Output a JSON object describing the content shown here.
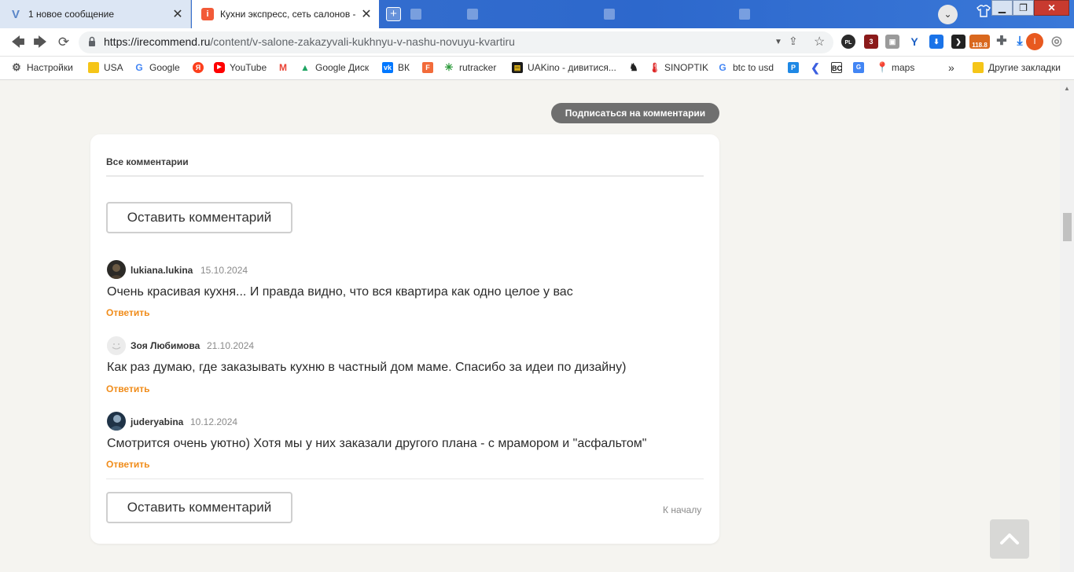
{
  "browser": {
    "tabs": [
      {
        "title": "1 новое сообщение",
        "favicon": "v-logo-icon",
        "active": false
      },
      {
        "title": "Кухни экспресс, сеть салонов - «В",
        "favicon": "irecommend-icon",
        "active": true
      }
    ],
    "url": {
      "host": "https://irecommend.ru",
      "path": "/content/v-salone-zakazyvali-kukhnyu-v-nashu-novuyu-kvartiru"
    },
    "extensions": [
      {
        "name": "PL",
        "badge": "PL"
      },
      {
        "name": "3",
        "badge": "3"
      },
      {
        "name": "118.8",
        "badge": "118.8"
      }
    ],
    "profile_initial": "I",
    "bookmarks": [
      {
        "label": "Настройки",
        "icon": "gear-icon"
      },
      {
        "label": "USA",
        "icon": "folder-icon"
      },
      {
        "label": "Google",
        "icon": "google-icon"
      },
      {
        "label": "",
        "icon": "yandex-icon"
      },
      {
        "label": "YouTube",
        "icon": "youtube-icon"
      },
      {
        "label": "",
        "icon": "gmail-icon"
      },
      {
        "label": "Google Диск",
        "icon": "drive-icon"
      },
      {
        "label": "ВК",
        "icon": "vk-icon"
      },
      {
        "label": "",
        "icon": "f-icon"
      },
      {
        "label": "rutracker",
        "icon": "rutracker-icon"
      },
      {
        "label": "UAKino - дивитися...",
        "icon": "uakino-icon"
      },
      {
        "label": "",
        "icon": "chess-icon"
      },
      {
        "label": "SINOPTIK",
        "icon": "thermometer-icon"
      },
      {
        "label": "btc to usd",
        "icon": "google-icon"
      },
      {
        "label": "",
        "icon": "p-icon"
      },
      {
        "label": "",
        "icon": "chevron-icon"
      },
      {
        "label": "",
        "icon": "bc-icon"
      },
      {
        "label": "",
        "icon": "translate-icon"
      },
      {
        "label": "maps",
        "icon": "maps-icon"
      },
      {
        "label": "»",
        "icon": ""
      },
      {
        "label": "Другие закладки",
        "icon": "folder-icon"
      }
    ]
  },
  "page": {
    "subscribe_label": "Подписаться на комментарии",
    "section_title": "Все комментарии",
    "leave_comment_label": "Оставить комментарий",
    "reply_label": "Ответить",
    "to_top_label": "К началу",
    "comments": [
      {
        "author": "lukiana.lukina",
        "date": "15.10.2024",
        "text": "Очень красивая кухня... И правда видно, что вся квартира как одно целое у вас",
        "avatar": "photo-dark"
      },
      {
        "author": "Зоя Любимова",
        "date": "21.10.2024",
        "text": "Как раз думаю, где заказывать кухню в частный дом маме. Спасибо за идеи по дизайну)",
        "avatar": "smiley-placeholder"
      },
      {
        "author": "juderyabina",
        "date": "10.12.2024",
        "text": "Смотрится очень уютно) Хотя мы у них заказали другого плана - с мрамором и \"асфальтом\"",
        "avatar": "photo-blue"
      }
    ]
  },
  "colors": {
    "accent": "#f08c1a",
    "subscribe_bg": "#6f6f6f",
    "page_bg": "#f5f4f0"
  }
}
